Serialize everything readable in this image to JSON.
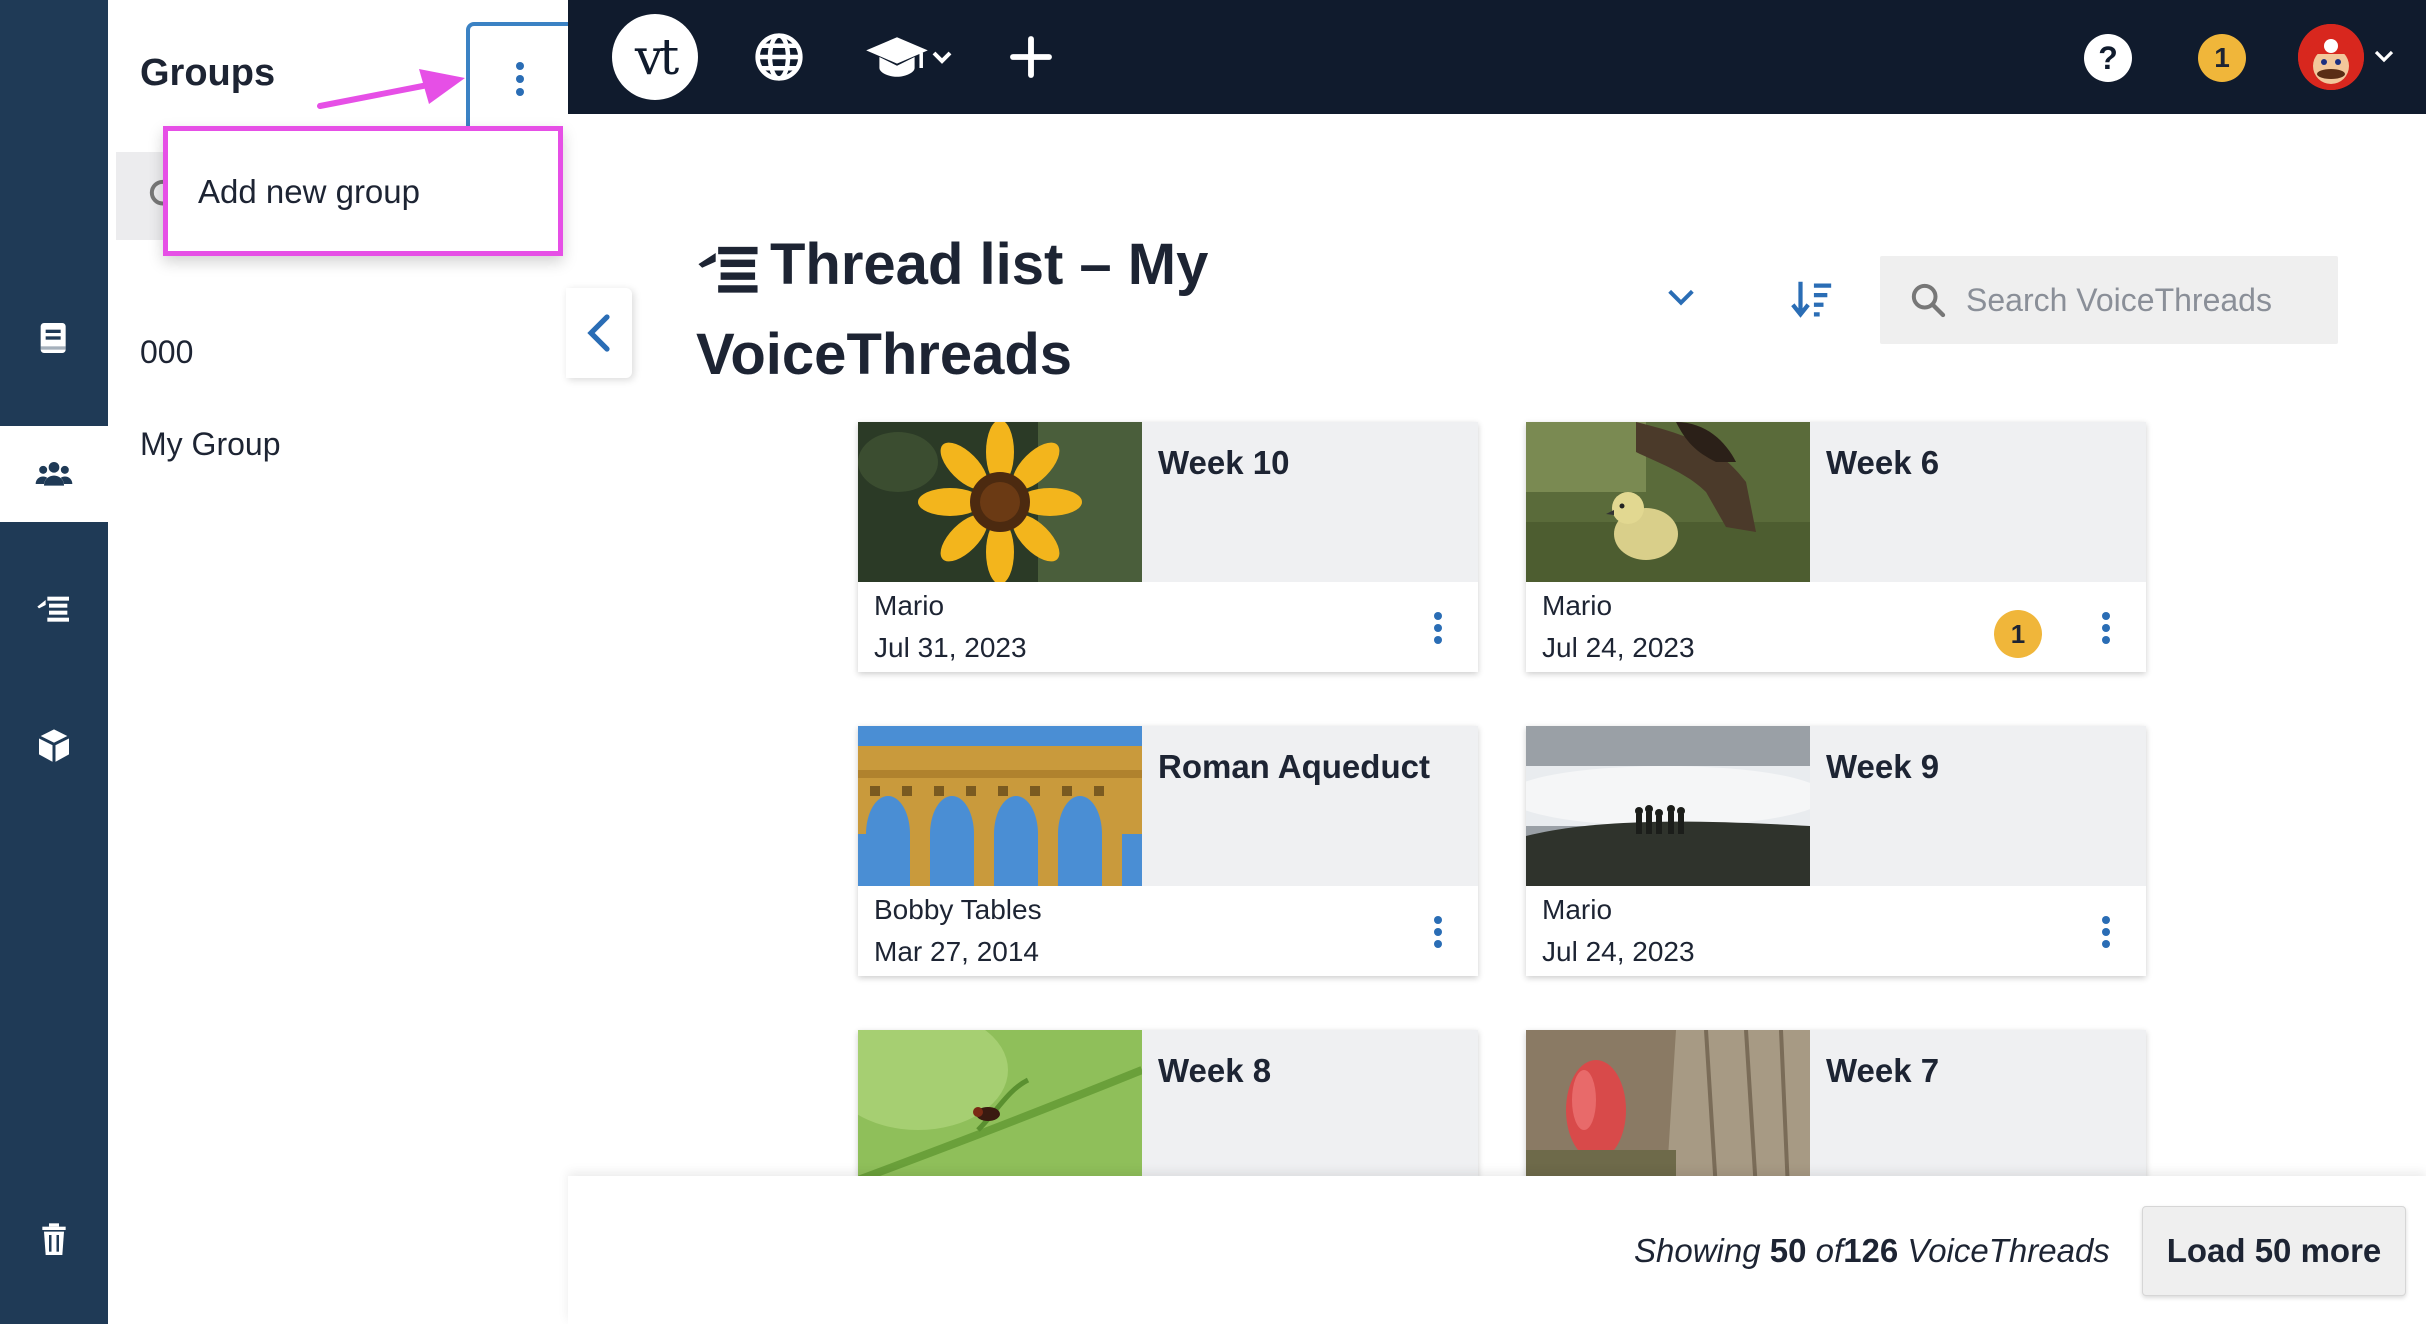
{
  "rail": {
    "items": [
      {
        "icon": "book-icon"
      },
      {
        "icon": "groups-icon",
        "active": true
      },
      {
        "icon": "threads-icon"
      },
      {
        "icon": "cube-icon"
      },
      {
        "icon": "trash-icon"
      }
    ]
  },
  "groups_panel": {
    "title": "Groups",
    "menu": {
      "add_new_group": "Add new group"
    },
    "groups": [
      "000",
      "My Group"
    ]
  },
  "topbar": {
    "logo_text": "vt",
    "notification_count": "1",
    "help_label": "?"
  },
  "main": {
    "title": "Thread list – My VoiceThreads",
    "search_placeholder": "Search VoiceThreads",
    "cards": [
      {
        "title": "Week 10",
        "author": "Mario",
        "date": "Jul 31, 2023",
        "thumb": "sunflower"
      },
      {
        "title": "Week 6",
        "author": "Mario",
        "date": "Jul 24, 2023",
        "thumb": "gosling",
        "badge": "1"
      },
      {
        "title": "Roman Aqueduct",
        "author": "Bobby Tables",
        "date": "Mar 27, 2014",
        "thumb": "aqueduct"
      },
      {
        "title": "Week 9",
        "author": "Mario",
        "date": "Jul 24, 2023",
        "thumb": "fog-hikers"
      },
      {
        "title": "Week 8",
        "author": "",
        "date": "",
        "thumb": "insect-on-plant"
      },
      {
        "title": "Week 7",
        "author": "",
        "date": "",
        "thumb": "red-fungus-tree"
      }
    ]
  },
  "footer": {
    "showing_prefix": "Showing",
    "shown_count": "50",
    "of_label": "of",
    "total_count": "126",
    "suffix": "VoiceThreads",
    "load_more_label": "Load 50 more"
  },
  "colors": {
    "rail_bg": "#1f3a56",
    "topbar_bg": "#101b2d",
    "accent_blue": "#2a6db5",
    "highlight_magenta": "#e64fe6",
    "badge_yellow": "#f0b63a"
  }
}
